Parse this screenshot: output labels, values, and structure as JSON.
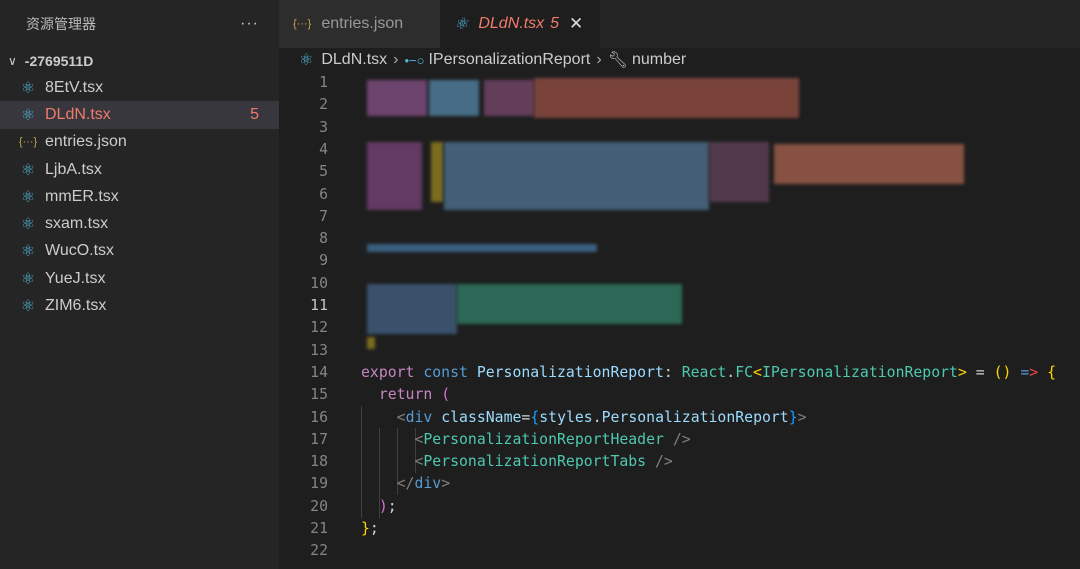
{
  "sidebar": {
    "title": "资源管理器",
    "more": "···",
    "folder": "-2769511D",
    "files": [
      {
        "name": "8EtV.tsx",
        "icon": "react-icon"
      },
      {
        "name": "DLdN.tsx",
        "icon": "react-icon",
        "badge": "5",
        "selected": true
      },
      {
        "name": "entries.json",
        "icon": "json-icon"
      },
      {
        "name": "LjbA.tsx",
        "icon": "react-icon"
      },
      {
        "name": "mmER.tsx",
        "icon": "react-icon"
      },
      {
        "name": "sxam.tsx",
        "icon": "react-icon"
      },
      {
        "name": "WucO.tsx",
        "icon": "react-icon"
      },
      {
        "name": "YueJ.tsx",
        "icon": "react-icon"
      },
      {
        "name": "ZIM6.tsx",
        "icon": "react-icon"
      }
    ]
  },
  "tabs": [
    {
      "label": "entries.json",
      "icon": "json-icon"
    },
    {
      "label": "DLdN.tsx",
      "badge": "5",
      "icon": "react-icon",
      "active": true
    }
  ],
  "breadcrumb": [
    "DLdN.tsx",
    "IPersonalizationReport",
    "number"
  ],
  "editor": {
    "current_line": 11,
    "lines": [
      {
        "n": "1"
      },
      {
        "n": "2"
      },
      {
        "n": "3"
      },
      {
        "n": "4"
      },
      {
        "n": "5"
      },
      {
        "n": "6"
      },
      {
        "n": "7"
      },
      {
        "n": "8"
      },
      {
        "n": "9"
      },
      {
        "n": "10"
      },
      {
        "n": "11"
      },
      {
        "n": "12"
      },
      {
        "n": "13"
      },
      {
        "n": "14",
        "tokens": [
          [
            "k",
            "export "
          ],
          [
            "b",
            "const "
          ],
          [
            "v",
            "PersonalizationReport"
          ],
          [
            "w",
            ": "
          ],
          [
            "t",
            "React"
          ],
          [
            "w",
            "."
          ],
          [
            "t",
            "FC"
          ],
          [
            "y",
            "<"
          ],
          [
            "t",
            "IPersonalizationReport"
          ],
          [
            "y",
            ">"
          ],
          [
            "w",
            " = "
          ],
          [
            "y",
            "()"
          ],
          [
            "w",
            " "
          ],
          [
            "b",
            "="
          ],
          [
            "r",
            ">"
          ],
          [
            "w",
            " "
          ],
          [
            "y",
            "{"
          ]
        ]
      },
      {
        "n": "15",
        "tokens": [
          [
            "w",
            "  "
          ],
          [
            "k",
            "return "
          ],
          [
            "p",
            "("
          ]
        ]
      },
      {
        "n": "16",
        "tokens": [
          [
            "w",
            "    "
          ],
          [
            "g",
            "<"
          ],
          [
            "b",
            "div"
          ],
          [
            "w",
            " "
          ],
          [
            "v",
            "className"
          ],
          [
            "w",
            "="
          ],
          [
            "lb",
            "{"
          ],
          [
            "v",
            "styles"
          ],
          [
            "w",
            "."
          ],
          [
            "v",
            "PersonalizationReport"
          ],
          [
            "lb",
            "}"
          ],
          [
            "g",
            ">"
          ]
        ]
      },
      {
        "n": "17",
        "tokens": [
          [
            "w",
            "      "
          ],
          [
            "g",
            "<"
          ],
          [
            "t",
            "PersonalizationReportHeader"
          ],
          [
            "w",
            " "
          ],
          [
            "g",
            "/>"
          ]
        ]
      },
      {
        "n": "18",
        "tokens": [
          [
            "w",
            "      "
          ],
          [
            "g",
            "<"
          ],
          [
            "t",
            "PersonalizationReportTabs"
          ],
          [
            "w",
            " "
          ],
          [
            "g",
            "/>"
          ]
        ]
      },
      {
        "n": "19",
        "tokens": [
          [
            "w",
            "    "
          ],
          [
            "g",
            "</"
          ],
          [
            "b",
            "div"
          ],
          [
            "g",
            ">"
          ]
        ]
      },
      {
        "n": "20",
        "tokens": [
          [
            "w",
            "  "
          ],
          [
            "p",
            ")"
          ],
          [
            "w",
            ";"
          ]
        ]
      },
      {
        "n": "21",
        "tokens": [
          [
            "y",
            "}"
          ],
          [
            "w",
            ";"
          ]
        ]
      },
      {
        "n": "22"
      }
    ]
  },
  "colors": {
    "accent_error": "#f07b6b",
    "react": "#4fb6d8",
    "json": "#c5a34a"
  }
}
